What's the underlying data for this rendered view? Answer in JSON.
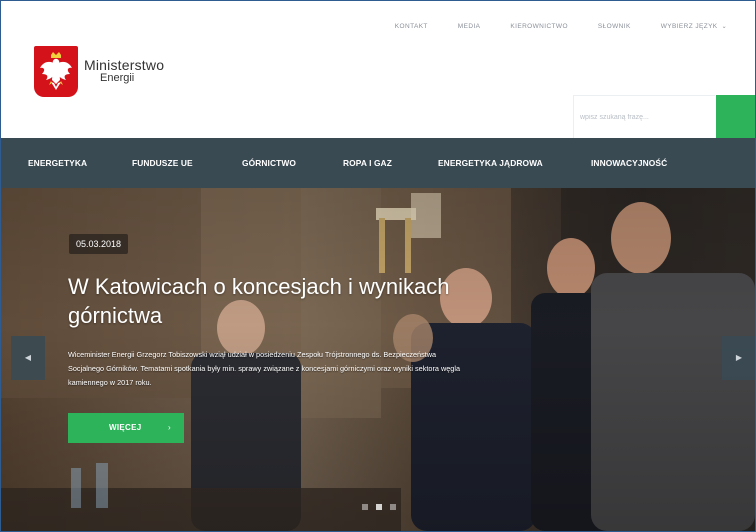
{
  "header": {
    "logo": {
      "line1": "Ministerstwo",
      "line2": "Energii"
    },
    "topnav": [
      {
        "label": "KONTAKT"
      },
      {
        "label": "MEDIA"
      },
      {
        "label": "KIEROWNICTWO"
      },
      {
        "label": "SŁOWNIK"
      }
    ],
    "language": {
      "label": "WYBIERZ JĘZYK",
      "icon": "chevron-down-icon"
    },
    "search": {
      "placeholder": "wpisz szukaną frazę...",
      "button_icon": "search-icon"
    }
  },
  "mainnav": {
    "items": [
      {
        "label": "ENERGETYKA"
      },
      {
        "label": "FUNDUSZE UE"
      },
      {
        "label": "GÓRNICTWO"
      },
      {
        "label": "ROPA I GAZ"
      },
      {
        "label": "ENERGETYKA JĄDROWA"
      },
      {
        "label": "INNOWACYJNOŚĆ"
      }
    ]
  },
  "hero": {
    "date": "05.03.2018",
    "title": "W Katowicach o koncesjach i wynikach górnictwa",
    "description": "Wiceminister Energii Grzegorz Tobiszowski wziął udział w posiedzeniu Zespołu Trójstronnego ds. Bezpieczeństwa Socjalnego Górników. Tematami spotkania były min. sprawy związane z koncesjami górniczymi oraz wyniki sektora węgla kamiennego w 2017 roku.",
    "more_label": "WIĘCEJ",
    "more_arrow": "›",
    "prev_icon": "chevron-left-icon",
    "next_icon": "chevron-right-icon",
    "slides": 3,
    "active_slide": 2
  },
  "colors": {
    "accent": "#2db35a",
    "nav_bg": "#3a4a53",
    "emblem_red": "#d4121a"
  }
}
